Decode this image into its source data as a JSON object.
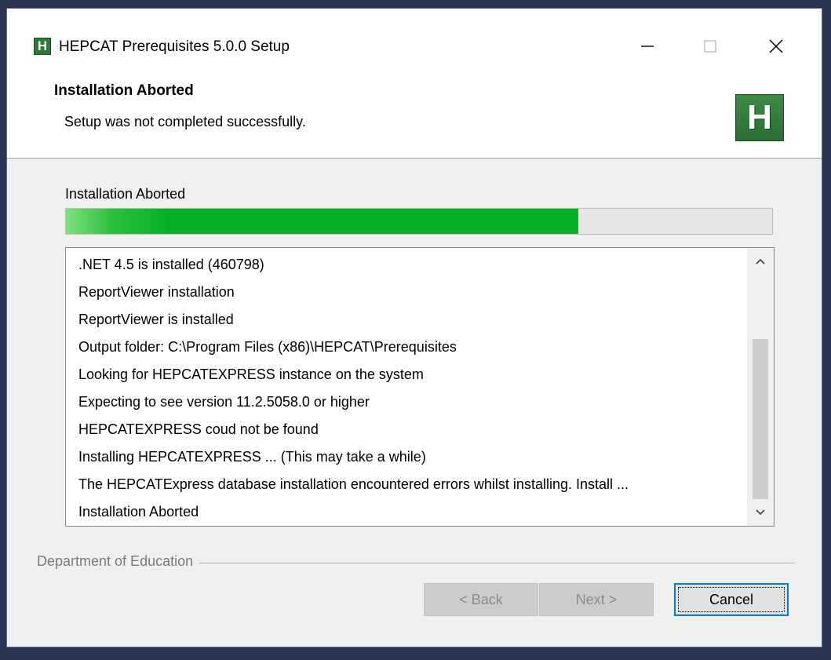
{
  "window": {
    "title": "HEPCAT Prerequisites 5.0.0 Setup",
    "app_icon_letter": "H"
  },
  "header": {
    "title": "Installation Aborted",
    "subtitle": "Setup was not completed successfully.",
    "logo_letter": "H"
  },
  "status": {
    "label": "Installation Aborted",
    "progress_percent": 72.5,
    "progress_color": "#06b025"
  },
  "log": {
    "lines": [
      ".NET 4.5 is installed (460798)",
      "ReportViewer installation",
      "ReportViewer is installed",
      "Output folder: C:\\Program Files (x86)\\HEPCAT\\Prerequisites",
      "Looking for HEPCATEXPRESS instance on the system",
      "Expecting to see version 11.2.5058.0 or higher",
      "HEPCATEXPRESS coud not be found",
      "Installing HEPCATEXPRESS ... (This may take a while)",
      "The HEPCATExpress database installation encountered errors whilst installing. Install ...",
      "Installation Aborted"
    ]
  },
  "footer": {
    "brand": "Department of Education"
  },
  "buttons": {
    "back_label": "< Back",
    "next_label": "Next >",
    "cancel_label": "Cancel"
  },
  "icons": {
    "minimize": "minimize-icon",
    "maximize": "maximize-icon",
    "close": "close-icon",
    "scroll_up": "chevron-up-icon",
    "scroll_down": "chevron-down-icon"
  }
}
